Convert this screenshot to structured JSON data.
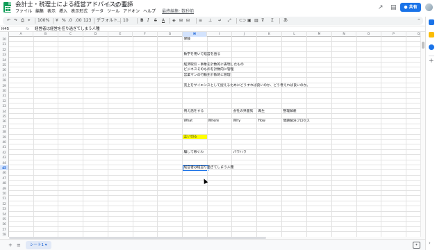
{
  "title": {
    "doc_title": "会計士・税理士による経営アドバイスの要諦",
    "star_icon": "☆",
    "move_icon": "⊡",
    "cloud_icon": "☁"
  },
  "menu": [
    "ファイル",
    "編集",
    "表示",
    "挿入",
    "表示形式",
    "データ",
    "ツール",
    "アドオン",
    "ヘルプ"
  ],
  "last_edit": "最終編集: 数秒前",
  "header_right": {
    "trend_icon": "↗",
    "comment_icon": "▤",
    "present_icon": "▭",
    "share_label": "共有"
  },
  "toolbar": {
    "undo": "↶",
    "redo": "↷",
    "print": "⎙",
    "paint": "⌖",
    "zoom": "100%",
    "currency": "¥",
    "percent": "%",
    "decimal_less": ".0",
    "decimal_more": ".00",
    "format": "123",
    "font": "デフォルト...",
    "font_size": "10",
    "bold": "B",
    "italic": "I",
    "strike": "S",
    "text_color": "A",
    "fill": "◈",
    "borders": "⊞",
    "merge": "⊟",
    "halign": "≡",
    "valign": "⊥",
    "wrap": "↵",
    "rotate": "⤢",
    "link": "⊂⊃",
    "comment": "▣",
    "chart": "▥",
    "filter": "⊽",
    "functions": "Σ",
    "input_tools": "あ",
    "collapse": "⌃"
  },
  "formula_bar": {
    "cell_ref": "H45",
    "fx": "fx",
    "content": "経営者は経営を任り過ぎてしまう人種"
  },
  "columns": [
    "A",
    "B",
    "C",
    "D",
    "E",
    "F",
    "G",
    "H",
    "I",
    "J",
    "K",
    "L",
    "M",
    "N",
    "O",
    "P",
    "Q"
  ],
  "selected_column": "H",
  "row_numbers": [
    20,
    21,
    22,
    23,
    24,
    25,
    26,
    27,
    28,
    29,
    30,
    31,
    32,
    33,
    34,
    35,
    36,
    37,
    38,
    39,
    40,
    41,
    42,
    43,
    44,
    45,
    46,
    47,
    48,
    49,
    50,
    51,
    52,
    53,
    54,
    55,
    56,
    57,
    58
  ],
  "selected_row": 45,
  "cells": {
    "r20_h": "保険",
    "r23_h": "数学を用いて経営を語る",
    "r25_h": "経済取引・事象を計数的に表現したもの",
    "r26_h": "ビジネスそのものを計数的に管理",
    "r27_h": "営業マンの行動を計数的に管理",
    "r29_h": "売上をサイエンスとして捉えるためにどうすれば良いのか、どう考えれば良いのか。",
    "r34_h": "例え話をする",
    "r34_j": "会社の界面気",
    "r34_k": "再生",
    "r34_l": "整理解雇",
    "r36_h": "What",
    "r36_i": "Where",
    "r36_j": "Why",
    "r36_k": "How",
    "r36_l": "問題解決プロセス",
    "r39_h": "言い切る",
    "r42_h": "騙して稼ぐわ",
    "r42_j": "パワハラ",
    "r45_h": "経営者は経営り過ぎてしまう人種"
  },
  "highlight_color": "#ffff00",
  "accent_color": "#1a73e8",
  "sheet": {
    "add_icon": "+",
    "list_icon": "≡",
    "tab_label": "シート1",
    "tab_caret": "▾",
    "explore_icon": "✦"
  },
  "side_panel": {
    "calendar_icon": "calendar-icon",
    "keep_icon": "keep-icon",
    "tasks_icon": "tasks-icon",
    "plus": "+",
    "expand": "›"
  }
}
